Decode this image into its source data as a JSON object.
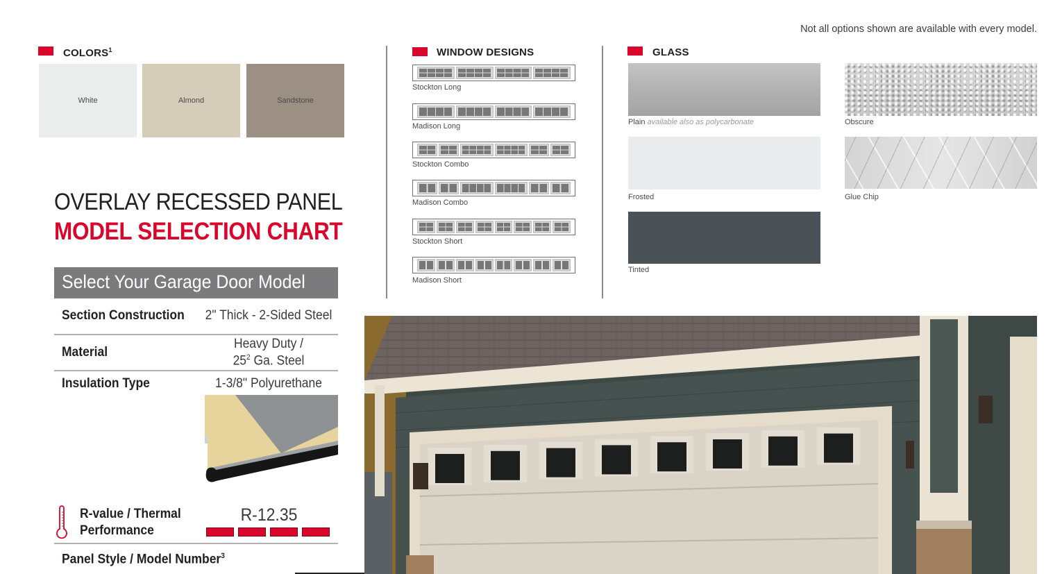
{
  "disclaimer": "Not all options shown are available with every model.",
  "colors_section": {
    "title": "COLORS",
    "footnote": "1",
    "marker_color": "#d9052b",
    "swatches": [
      {
        "label": "White",
        "color": "#ebecec"
      },
      {
        "label": "Almond",
        "color": "#d6ccba"
      },
      {
        "label": "Sandstone",
        "color": "#9c8f84"
      }
    ]
  },
  "window_designs": {
    "title": "WINDOW DESIGNS",
    "items": [
      {
        "label": "Stockton Long"
      },
      {
        "label": "Madison Long"
      },
      {
        "label": "Stockton Combo"
      },
      {
        "label": "Madison Combo"
      },
      {
        "label": "Stockton Short"
      },
      {
        "label": "Madison Short"
      }
    ]
  },
  "glass": {
    "title": "GLASS",
    "items": [
      {
        "label": "Plain",
        "note": "available also as polycarbonate"
      },
      {
        "label": "Obscure"
      },
      {
        "label": "Frosted"
      },
      {
        "label": "Glue Chip"
      },
      {
        "label": "Tinted"
      }
    ]
  },
  "model_chart": {
    "title_line1": "OVERLAY RECESSED PANEL",
    "title_line2": "MODEL SELECTION CHART",
    "select_header": "Select Your Garage Door Model",
    "rows": [
      {
        "label": "Section Construction",
        "value": "2\" Thick - 2-Sided Steel"
      },
      {
        "label": "Material",
        "value_line1": "Heavy Duty /",
        "value_line2_main": "25",
        "value_line2_sup": "2",
        "value_line2_rest": " Ga. Steel"
      },
      {
        "label": "Insulation Type",
        "value": "1-3/8\" Polyurethane"
      }
    ],
    "rvalue": {
      "label_line1": "R-value / Thermal",
      "label_line2": "Performance",
      "value": "R-12.35",
      "rating_filled": 4,
      "rating_max": 4,
      "rating_color": "#d9052b"
    },
    "panel_style_label": "Panel Style / Model Number",
    "panel_style_footnote": "3"
  }
}
